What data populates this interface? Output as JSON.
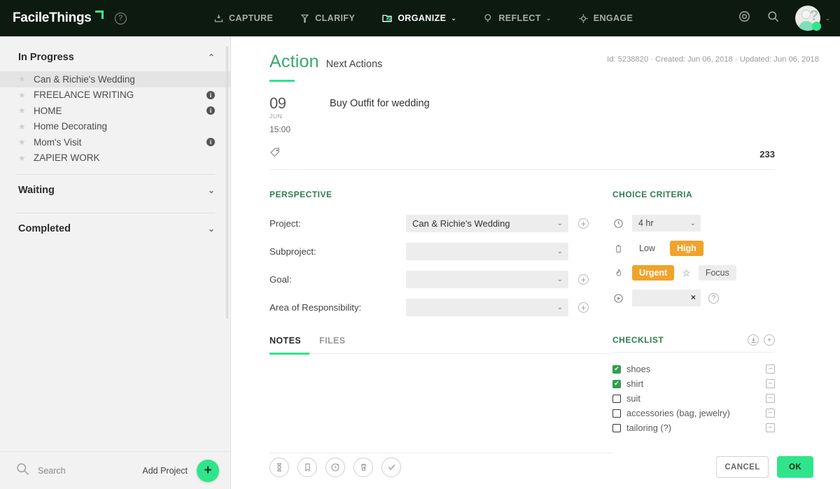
{
  "brand": {
    "name": "FacileThings"
  },
  "topnav": {
    "items": [
      {
        "label": "CAPTURE",
        "icon": "inbox-download-icon",
        "active": false,
        "caret": false
      },
      {
        "label": "CLARIFY",
        "icon": "funnel-arrow-icon",
        "active": false,
        "caret": false
      },
      {
        "label": "ORGANIZE",
        "icon": "folder-check-icon",
        "active": true,
        "caret": true
      },
      {
        "label": "REFLECT",
        "icon": "magnify-thought-icon",
        "active": false,
        "caret": true
      },
      {
        "label": "ENGAGE",
        "icon": "target-crosshair-icon",
        "active": false,
        "caret": false
      }
    ],
    "help_glyph": "?",
    "target_icon": "target-icon",
    "search_icon": "search-icon",
    "avatar_caret": "⌄"
  },
  "sidebar": {
    "groups": [
      {
        "title": "In Progress",
        "caret": "⌃",
        "expanded": true,
        "items": [
          {
            "label": "Can & Richie's Wedding",
            "selected": true,
            "info": false
          },
          {
            "label": "FREELANCE WRITING",
            "selected": false,
            "info": true
          },
          {
            "label": "HOME",
            "selected": false,
            "info": true
          },
          {
            "label": "Home Decorating",
            "selected": false,
            "info": false
          },
          {
            "label": "Mom's Visit",
            "selected": false,
            "info": true
          },
          {
            "label": "ZAPIER WORK",
            "selected": false,
            "info": false
          }
        ]
      },
      {
        "title": "Waiting",
        "caret": "⌄",
        "expanded": false,
        "items": []
      },
      {
        "title": "Completed",
        "caret": "⌄",
        "expanded": false,
        "items": []
      }
    ],
    "info_badge_glyph": "i",
    "footer": {
      "search_label": "Search",
      "add_project_label": "Add Project",
      "fab_glyph": "+"
    }
  },
  "main": {
    "title": "Action",
    "subtitle": "Next Actions",
    "meta": "Id: 5238820 · Created: Jun 06, 2018 · Updated: Jun 06, 2018",
    "task": {
      "day": "09",
      "month": "JUN",
      "time": "15:00",
      "title": "Buy Outfit for wedding"
    },
    "tag_icon": "tag-icon",
    "tag_count": "233"
  },
  "perspective": {
    "section_title": "PERSPECTIVE",
    "rows": [
      {
        "label": "Project:",
        "value": "Can & Richie's Wedding",
        "has_add": true
      },
      {
        "label": "Subproject:",
        "value": "",
        "has_add": false
      },
      {
        "label": "Goal:",
        "value": "",
        "has_add": true
      },
      {
        "label": "Area of Responsibility:",
        "value": "",
        "has_add": true
      }
    ],
    "caret": "⌄",
    "add_glyph": "+"
  },
  "choice_criteria": {
    "section_title": "CHOICE CRITERIA",
    "time": {
      "icon": "clock-icon",
      "value": "4 hr",
      "caret": "⌄"
    },
    "energy": {
      "icon": "battery-icon",
      "low_label": "Low",
      "high_label": "High",
      "selected": "High"
    },
    "priority": {
      "icon": "flame-icon",
      "urgent_label": "Urgent",
      "star_glyph": "☆",
      "focus_label": "Focus",
      "selected": "Urgent"
    },
    "context": {
      "icon": "play-circle-icon",
      "value": "",
      "clear_glyph": "×",
      "help_glyph": "?"
    }
  },
  "tabs": {
    "items": [
      {
        "label": "NOTES",
        "active": true
      },
      {
        "label": "FILES",
        "active": false
      }
    ]
  },
  "checklist": {
    "section_title": "CHECKLIST",
    "header_icons": [
      {
        "name": "import-checklist-icon",
        "glyph": "⤓"
      },
      {
        "name": "add-checklist-item-icon",
        "glyph": "+"
      }
    ],
    "items": [
      {
        "label": "shoes",
        "checked": true
      },
      {
        "label": "shirt",
        "checked": true
      },
      {
        "label": "suit",
        "checked": false
      },
      {
        "label": "accessories (bag, jewelry)",
        "checked": false
      },
      {
        "label": "tailoring (?)",
        "checked": false
      }
    ],
    "remove_glyph": "−",
    "check_glyph": "✔"
  },
  "footer": {
    "tools": [
      {
        "name": "hourglass-defer-icon",
        "glyph": "⧗"
      },
      {
        "name": "bookmark-icon",
        "glyph": "🔖"
      },
      {
        "name": "repeat-clock-icon",
        "glyph": "↻"
      },
      {
        "name": "trash-delete-icon",
        "glyph": "🗑"
      },
      {
        "name": "check-complete-icon",
        "glyph": "✓"
      }
    ],
    "cancel_label": "CANCEL",
    "ok_label": "OK"
  },
  "colors": {
    "header_bg": "#0d1a0f",
    "accent_green": "#2fe58a",
    "section_green": "#2f7d4f",
    "orange": "#f0a32b",
    "sidebar_bg": "#f2f2f2"
  }
}
